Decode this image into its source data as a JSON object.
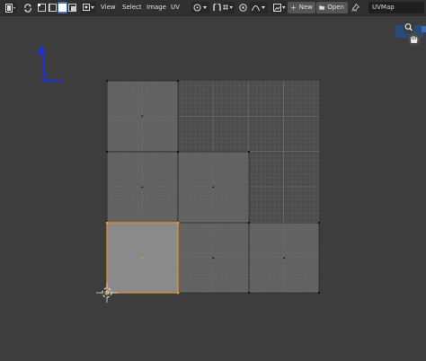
{
  "header": {
    "menus": [
      "View",
      "Select",
      "Image",
      "UV"
    ],
    "new_label": "New",
    "open_label": "Open",
    "uv_map_name": "UVMap"
  },
  "icons": {
    "editor_type": "image-editor-icon",
    "sync_selection": "uv-sync-selection-icon",
    "select_modes": [
      "vertex-select-icon",
      "edge-select-icon",
      "face-select-icon",
      "island-select-icon"
    ],
    "sticky_mode": "sticky-select-mode-icon",
    "pivot": "pivot-point-icon",
    "snap": "snap-icon",
    "proportional": "proportional-edit-icon",
    "falloff": "falloff-curve-icon",
    "image_browse": "image-browse-icon",
    "pin": "pin-icon",
    "zoom": "zoom-icon",
    "pan": "hand-pan-icon",
    "cursor_2d": "2d-cursor-icon",
    "uv_gizmo": "uv-axis-gizmo"
  },
  "colors": {
    "background": "#3d3d3d",
    "header": "#303030",
    "grid": "#656565",
    "selection": "#e0892c",
    "active_button": "#4772b3",
    "gizmo": "#1f2fd6"
  }
}
